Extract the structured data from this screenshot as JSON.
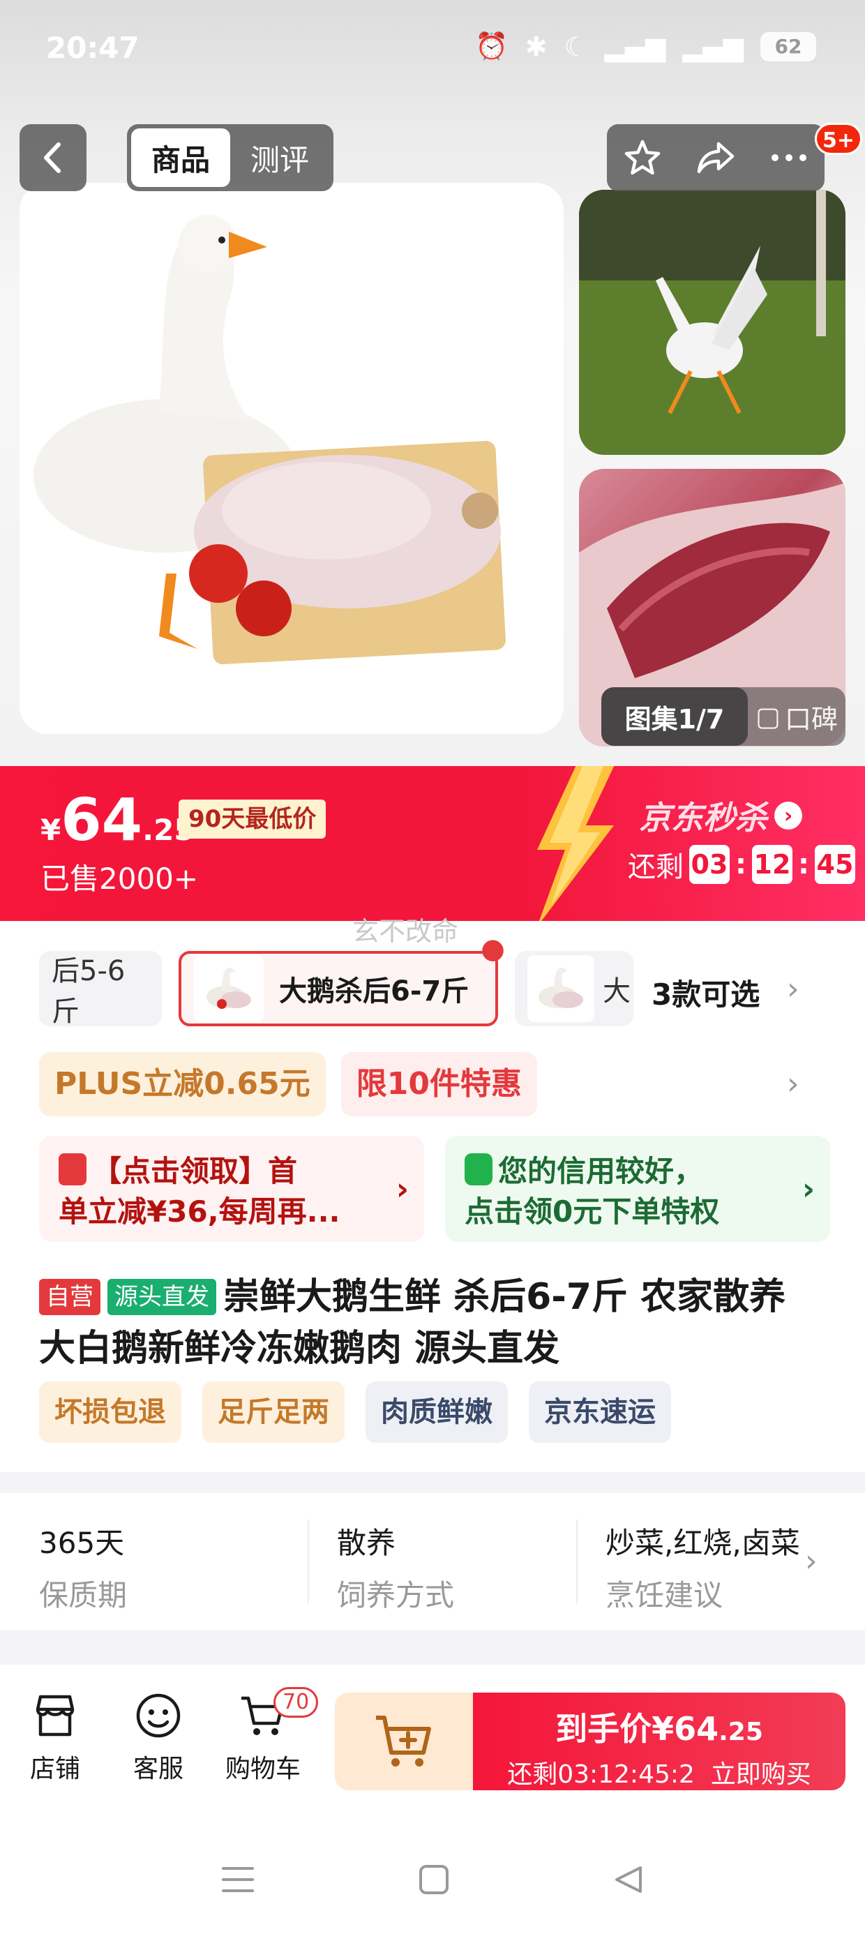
{
  "status_bar": {
    "time": "20:47",
    "battery": "62"
  },
  "nav": {
    "tab_product": "商品",
    "tab_review": "测评",
    "notif_count": "5+"
  },
  "gallery": {
    "counter": "图集1/7",
    "koubei": "口碑"
  },
  "flash_sale": {
    "currency": "¥",
    "price_int": "64",
    "price_dec": ".25",
    "low_tag": "90天最低价",
    "sold": "已售2000+",
    "title": "京东秒杀",
    "remain_label": "还剩",
    "countdown": {
      "h": "03",
      "m": "12",
      "s": "45"
    }
  },
  "watermark": "玄不改命",
  "variants": {
    "items": [
      {
        "label": "后5-6斤"
      },
      {
        "label": "大鹅杀后6-7斤"
      },
      {
        "label": "大"
      }
    ],
    "count_label": "3款可选"
  },
  "promos": {
    "plus": "PLUS立减0.65元",
    "limit": "限10件特惠"
  },
  "coupons": {
    "c1_line1": "【点击领取】首",
    "c1_line2": "单立减¥36,每周再...",
    "c2_line1": "您的信用较好，",
    "c2_line2": "点击领0元下单特权"
  },
  "product": {
    "tag_self": "自营",
    "tag_source": "源头直发",
    "title": "崇鲜大鹅生鲜 杀后6-7斤 农家散养大白鹅新鲜冷冻嫩鹅肉 源头直发"
  },
  "features": [
    "坏损包退",
    "足斤足两",
    "肉质鲜嫩",
    "京东速运"
  ],
  "specs": [
    {
      "value": "365天",
      "key": "保质期"
    },
    {
      "value": "散养",
      "key": "饲养方式"
    },
    {
      "value": "炒菜,红烧,卤菜",
      "key": "烹饪建议"
    }
  ],
  "bottom_bar": {
    "shop": "店铺",
    "service": "客服",
    "cart": "购物车",
    "cart_count": "70",
    "buy_label": "到手价",
    "buy_currency": "¥",
    "buy_price_int": "64",
    "buy_price_dec": ".25",
    "buy_countdown": "还剩03:12:45:2",
    "buy_now": "立即购买"
  },
  "colors": {
    "accent": "#f5163a",
    "jd_red": "#e4393c",
    "green": "#1aae6f"
  }
}
